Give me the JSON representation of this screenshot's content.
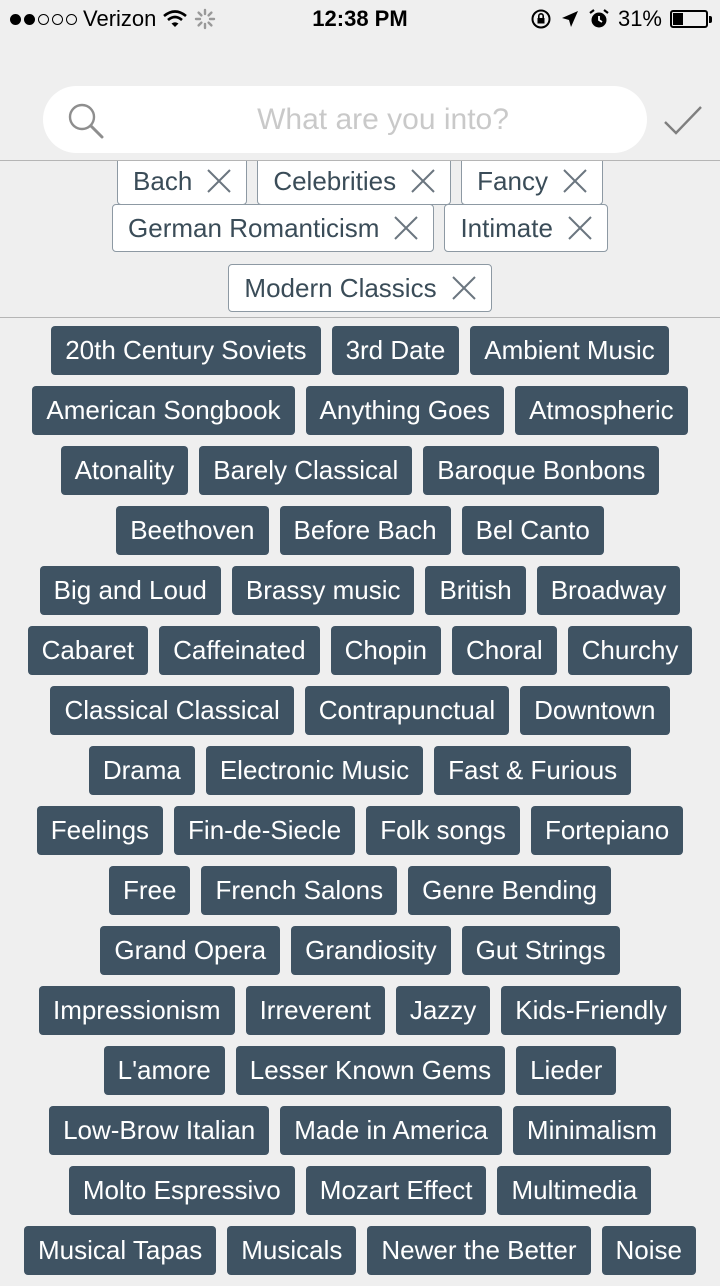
{
  "status_bar": {
    "carrier": "Verizon",
    "time": "12:38 PM",
    "battery": "31%",
    "battery_level": 0.31
  },
  "search": {
    "placeholder": "What are you into?",
    "value": ""
  },
  "selected_rows": [
    [
      "Bach",
      "Celebrities",
      "Fancy"
    ],
    [
      "German Romanticism",
      "Intimate"
    ],
    [
      "Modern Classics"
    ]
  ],
  "tag_rows": [
    [
      "20th Century Soviets",
      "3rd Date",
      "Ambient Music"
    ],
    [
      "American Songbook",
      "Anything Goes",
      "Atmospheric"
    ],
    [
      "Atonality",
      "Barely Classical",
      "Baroque Bonbons"
    ],
    [
      "Beethoven",
      "Before Bach",
      "Bel Canto"
    ],
    [
      "Big and Loud",
      "Brassy music",
      "British",
      "Broadway"
    ],
    [
      "Cabaret",
      "Caffeinated",
      "Chopin",
      "Choral",
      "Churchy"
    ],
    [
      "Classical Classical",
      "Contrapunctual",
      "Downtown"
    ],
    [
      "Drama",
      "Electronic Music",
      "Fast & Furious"
    ],
    [
      "Feelings",
      "Fin-de-Siecle",
      "Folk songs",
      "Fortepiano"
    ],
    [
      "Free",
      "French Salons",
      "Genre Bending"
    ],
    [
      "Grand Opera",
      "Grandiosity",
      "Gut Strings"
    ],
    [
      "Impressionism",
      "Irreverent",
      "Jazzy",
      "Kids-Friendly"
    ],
    [
      "L'amore",
      "Lesser Known Gems",
      "Lieder"
    ],
    [
      "Low-Brow Italian",
      "Made in America",
      "Minimalism"
    ],
    [
      "Molto Espressivo",
      "Mozart Effect",
      "Multimedia"
    ],
    [
      "Musical Tapas",
      "Musicals",
      "Newer the Better",
      "Noise"
    ]
  ],
  "colors": {
    "tag_background": "#3f5363",
    "chip_border": "#8d99a3",
    "page_background": "#efefef"
  },
  "icons": [
    "wifi-icon",
    "activity-spinner-icon",
    "rotation-lock-icon",
    "location-arrow-icon",
    "alarm-icon",
    "battery-icon",
    "search-icon",
    "checkmark-icon",
    "remove-x-icon"
  ]
}
